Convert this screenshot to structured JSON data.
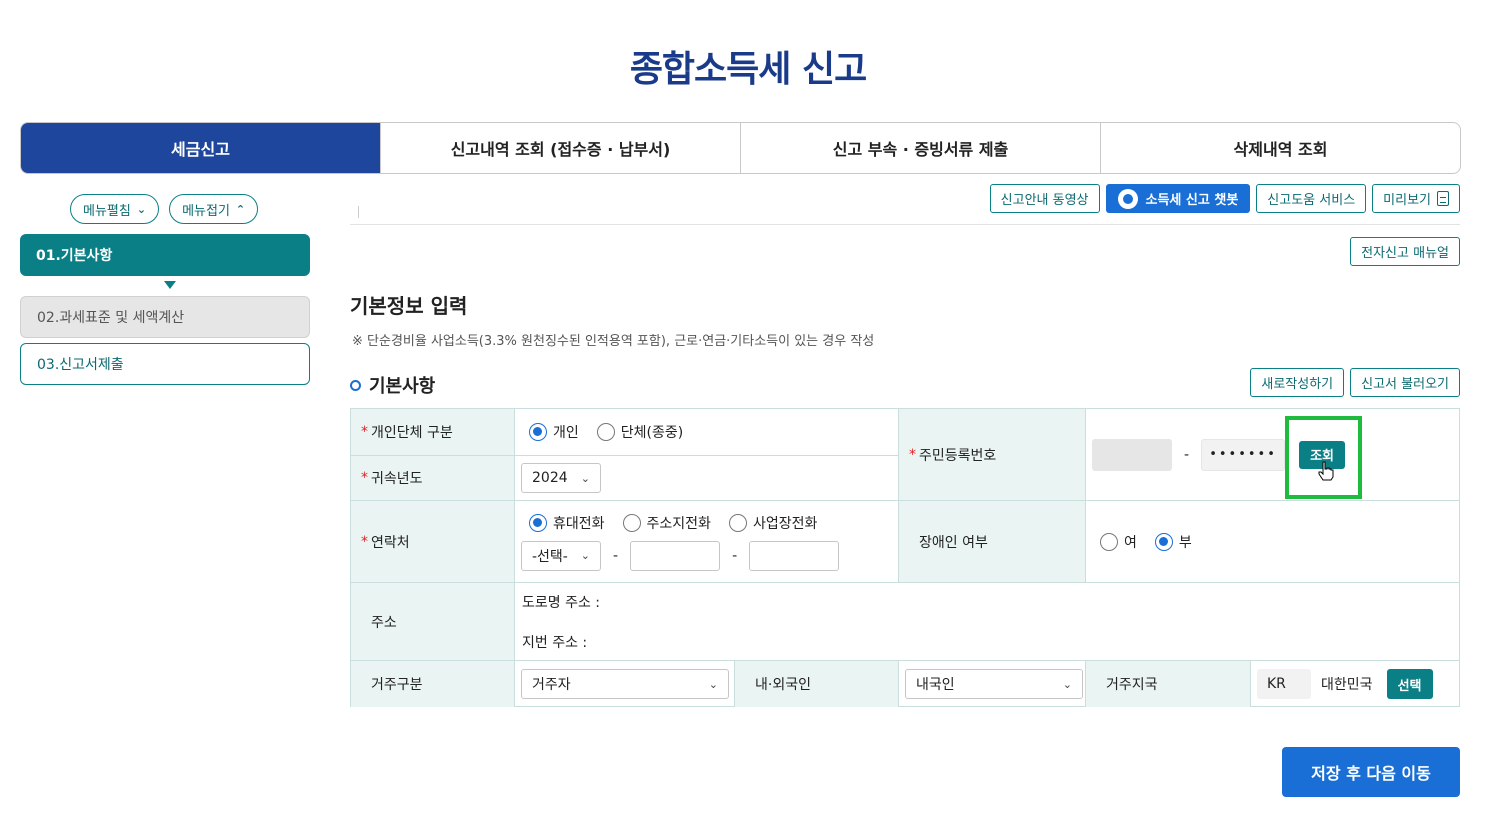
{
  "page_title": "종합소득세 신고",
  "tabs": [
    {
      "label": "세금신고",
      "active": true
    },
    {
      "label": "신고내역 조회 (접수증 · 납부서)",
      "active": false
    },
    {
      "label": "신고 부속 · 증빙서류 제출",
      "active": false
    },
    {
      "label": "삭제내역 조회",
      "active": false
    }
  ],
  "sidebar": {
    "expand_label": "메뉴펼침",
    "collapse_label": "메뉴접기",
    "steps": [
      "01.기본사항",
      "02.과세표준 및 세액계산",
      "03.신고서제출"
    ]
  },
  "toolbar": {
    "video_guide": "신고안내 동영상",
    "chatbot": "소득세 신고 챗봇",
    "help_service": "신고도움 서비스",
    "preview": "미리보기",
    "manual": "전자신고 매뉴얼"
  },
  "section": {
    "title": "기본정보 입력",
    "note": "※ 단순경비율 사업소득(3.3% 원천징수된 인적용역 포함), 근로·연금·기타소득이 있는 경우 작성",
    "subtitle": "기본사항",
    "new_btn": "새로작성하기",
    "load_btn": "신고서 불러오기"
  },
  "form": {
    "type_label": "개인단체 구분",
    "type_options": [
      "개인",
      "단체(종중)"
    ],
    "type_selected": "개인",
    "year_label": "귀속년도",
    "year_value": "2024",
    "rrn_label": "주민등록번호",
    "rrn_dash": "-",
    "rrn_back_masked": "•••••••",
    "rrn_lookup_btn": "조회",
    "contact_label": "연락처",
    "contact_options": [
      "휴대전화",
      "주소지전화",
      "사업장전화"
    ],
    "contact_selected": "휴대전화",
    "contact_prefix_placeholder": "-선택-",
    "phone_dash": "-",
    "disabled_label": "장애인 여부",
    "disabled_options": [
      "여",
      "부"
    ],
    "disabled_selected": "부",
    "address_label": "주소",
    "road_address_label": "도로명 주소 :",
    "lot_address_label": "지번 주소 :",
    "residence_label": "거주구분",
    "residence_value": "거주자",
    "nationality_label": "내·외국인",
    "nationality_value": "내국인",
    "country_label": "거주지국",
    "country_code": "KR",
    "country_name": "대한민국",
    "country_select_btn": "선택"
  },
  "save_next_btn": "저장 후 다음 이동",
  "colors": {
    "navy": "#1e469c",
    "teal": "#0b7f86",
    "blue": "#1a6fd6",
    "highlight": "#1fbb3f"
  }
}
